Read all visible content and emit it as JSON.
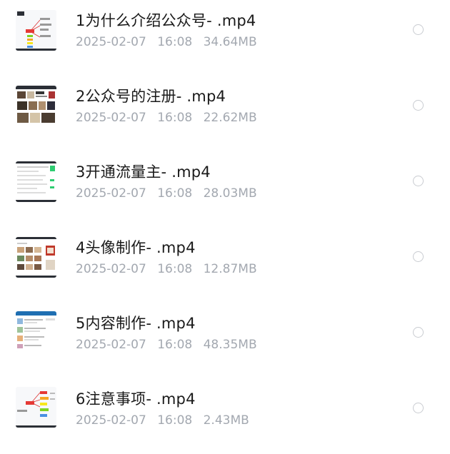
{
  "files": [
    {
      "name": "1为什么介绍公众号- .mp4",
      "date": "2025-02-07",
      "time": "16:08",
      "size": "34.64MB",
      "selected": false,
      "thumbnail": "mindmap-thumbnail"
    },
    {
      "name": "2公众号的注册- .mp4",
      "date": "2025-02-07",
      "time": "16:08",
      "size": "22.62MB",
      "selected": false,
      "thumbnail": "photo-grid-thumbnail"
    },
    {
      "name": "3开通流量主- .mp4",
      "date": "2025-02-07",
      "time": "16:08",
      "size": "28.03MB",
      "selected": false,
      "thumbnail": "settings-page-thumbnail"
    },
    {
      "name": "4头像制作- .mp4",
      "date": "2025-02-07",
      "time": "16:08",
      "size": "12.87MB",
      "selected": false,
      "thumbnail": "avatar-gallery-thumbnail"
    },
    {
      "name": "5内容制作- .mp4",
      "date": "2025-02-07",
      "time": "16:08",
      "size": "48.35MB",
      "selected": false,
      "thumbnail": "editor-page-thumbnail"
    },
    {
      "name": "6注意事项- .mp4",
      "date": "2025-02-07",
      "time": "16:08",
      "size": "2.43MB",
      "selected": false,
      "thumbnail": "mindmap-thumbnail"
    }
  ],
  "colors": {
    "title": "#1a1a1a",
    "meta": "#a3a8b0",
    "radio_border": "#c9ccd1"
  }
}
